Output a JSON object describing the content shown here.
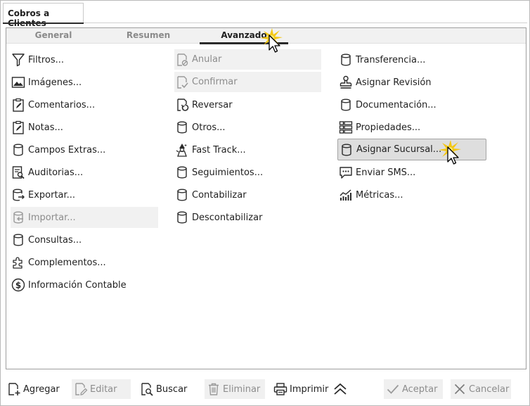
{
  "window": {
    "title": "Cobros a Clientes"
  },
  "tabs": [
    {
      "label": "General"
    },
    {
      "label": "Resumen"
    },
    {
      "label": "Avanzado",
      "active": true
    }
  ],
  "columns": [
    {
      "items": [
        {
          "label": "Filtros...",
          "icon": "filter-icon"
        },
        {
          "label": "Imágenes...",
          "icon": "image-icon"
        },
        {
          "label": "Comentarios...",
          "icon": "clipboard-edit-icon"
        },
        {
          "label": "Notas...",
          "icon": "clipboard-edit-icon"
        },
        {
          "label": "Campos Extras...",
          "icon": "database-icon"
        },
        {
          "label": "Auditorias...",
          "icon": "audit-search-icon"
        },
        {
          "label": "Exportar...",
          "icon": "database-export-icon"
        },
        {
          "label": "Importar...",
          "icon": "database-import-icon",
          "disabled": true
        },
        {
          "label": "Consultas...",
          "icon": "database-icon"
        },
        {
          "label": "Complementos...",
          "icon": "puzzle-icon"
        },
        {
          "label": "Información Contable",
          "icon": "dollar-circle-icon"
        }
      ]
    },
    {
      "items": [
        {
          "label": "Anular",
          "icon": "document-cancel-icon",
          "disabled": true
        },
        {
          "label": "Confirmar",
          "icon": "document-check-icon",
          "disabled": true
        },
        {
          "label": "Reversar",
          "icon": "document-undo-icon"
        },
        {
          "label": "Otros...",
          "icon": "database-icon"
        },
        {
          "label": "Fast Track...",
          "icon": "wizard-icon"
        },
        {
          "label": "Seguimientos...",
          "icon": "database-icon"
        },
        {
          "label": "Contabilizar",
          "icon": "database-icon"
        },
        {
          "label": "Descontabilizar",
          "icon": "database-icon"
        }
      ]
    },
    {
      "items": [
        {
          "label": "Transferencia...",
          "icon": "database-icon"
        },
        {
          "label": "Asignar Revisión",
          "icon": "stamp-icon"
        },
        {
          "label": "Documentación...",
          "icon": "database-icon"
        },
        {
          "label": "Propiedades...",
          "icon": "properties-grid-icon"
        },
        {
          "label": "Asignar Sucursal...",
          "icon": "database-icon",
          "highlighted": true
        },
        {
          "label": "Enviar SMS...",
          "icon": "sms-chat-icon"
        },
        {
          "label": "Métricas...",
          "icon": "metrics-chart-icon"
        }
      ]
    }
  ],
  "toolbar": {
    "agregar": "Agregar",
    "editar": "Editar",
    "buscar": "Buscar",
    "eliminar": "Eliminar",
    "imprimir": "Imprimir",
    "aceptar": "Aceptar",
    "cancelar": "Cancelar"
  },
  "colors": {
    "text": "#1f1f1f",
    "disabled_text": "#8c8c8c",
    "highlight_bg": "#dedede",
    "cursor_glow": "#f5c400"
  }
}
